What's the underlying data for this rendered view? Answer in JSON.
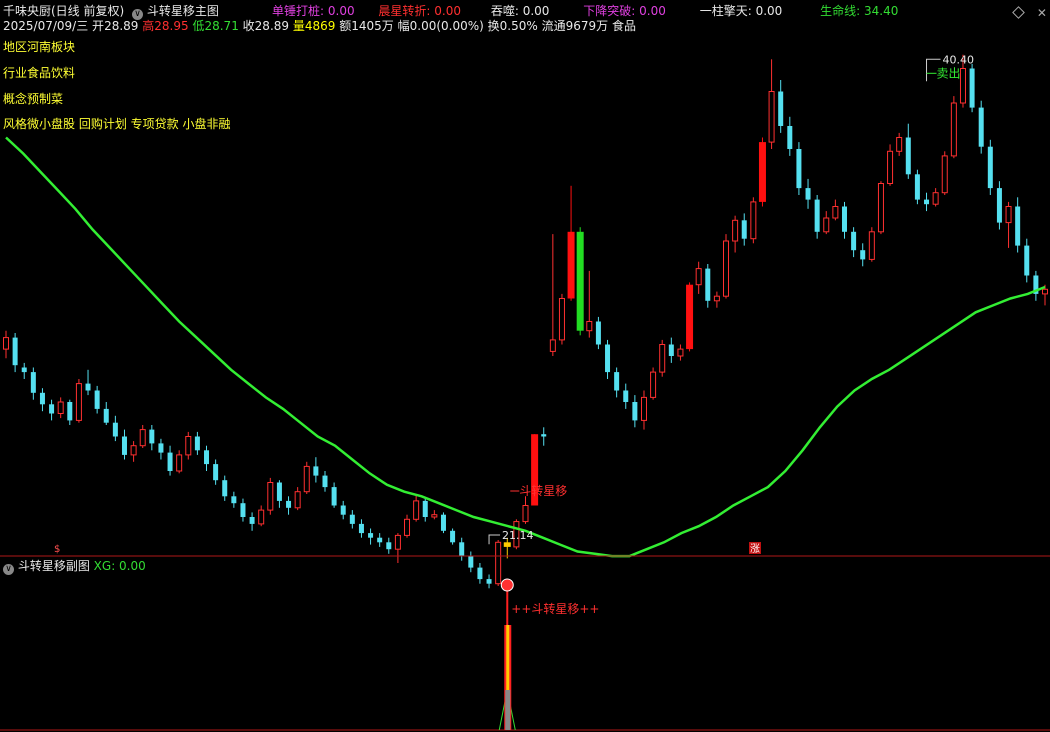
{
  "header": {
    "stock_name": "千味央厨(日线 前复权)",
    "formula_name": "斗转星移主图",
    "indicators": [
      {
        "label": "单锤打桩:",
        "value": "0.00",
        "color": "#e040e0"
      },
      {
        "label": "晨星转折:",
        "value": "0.00",
        "color": "#ff3030"
      },
      {
        "label": "吞噬:",
        "value": "0.00",
        "color": "#e8e8e8"
      },
      {
        "label": "下降突破:",
        "value": "0.00",
        "color": "#e040e0"
      },
      {
        "label": "一柱擎天:",
        "value": "0.00",
        "color": "#e8e8e8"
      },
      {
        "label": "生命线:",
        "value": "34.40",
        "color": "#33dd33"
      }
    ],
    "quote": {
      "date": "2025/07/09/三",
      "open_label": "开",
      "open": "28.89",
      "high_label": "高",
      "high": "28.95",
      "low_label": "低",
      "low": "28.71",
      "close_label": "收",
      "close": "28.89",
      "vol_label": "量",
      "vol": "4869",
      "amount": "额1405万",
      "change": "幅0.00(0.00%)",
      "turnover": "换0.50%",
      "float": "流通9679万",
      "sector": "食品"
    }
  },
  "side_info": [
    "地区河南板块",
    "行业食品饮料",
    "概念预制菜",
    "风格微小盘股 回购计划 专项贷款 小盘非融"
  ],
  "main_chart": {
    "high_label": "40.40",
    "sell_label": "卖出",
    "low_label": "21.14",
    "signal_label": "斗转星移",
    "bottom_markers": [
      "$",
      "涨"
    ],
    "colors": {
      "up": "#ff3030",
      "down": "#55e0f0",
      "ma": "#33ee33",
      "signal": "#ffcc00"
    },
    "ylim": [
      19.5,
      41.5
    ]
  },
  "sub_chart": {
    "title": "斗转星移副图",
    "xg_label": "XG: 0.00",
    "signal_label": "++斗转星移++"
  },
  "chart_data": {
    "type": "candlestick",
    "ohlc": [
      [
        27.8,
        28.6,
        27.4,
        28.3
      ],
      [
        28.3,
        28.5,
        26.8,
        27.1
      ],
      [
        27.0,
        27.2,
        26.5,
        26.8
      ],
      [
        26.8,
        27.0,
        25.6,
        25.9
      ],
      [
        25.9,
        26.1,
        25.1,
        25.4
      ],
      [
        25.4,
        25.6,
        24.7,
        25.0
      ],
      [
        25.0,
        25.7,
        24.8,
        25.5
      ],
      [
        25.5,
        25.6,
        24.5,
        24.7
      ],
      [
        24.7,
        26.5,
        24.6,
        26.3
      ],
      [
        26.3,
        26.9,
        25.8,
        26.0
      ],
      [
        26.0,
        26.2,
        25.0,
        25.2
      ],
      [
        25.2,
        25.5,
        24.5,
        24.6
      ],
      [
        24.6,
        24.9,
        23.8,
        24.0
      ],
      [
        24.0,
        24.3,
        23.0,
        23.2
      ],
      [
        23.2,
        23.8,
        22.9,
        23.6
      ],
      [
        23.6,
        24.5,
        23.5,
        24.3
      ],
      [
        24.3,
        24.5,
        23.4,
        23.7
      ],
      [
        23.7,
        23.9,
        23.0,
        23.3
      ],
      [
        23.3,
        23.6,
        22.3,
        22.5
      ],
      [
        22.5,
        23.4,
        22.4,
        23.2
      ],
      [
        23.2,
        24.2,
        23.0,
        24.0
      ],
      [
        24.0,
        24.2,
        23.2,
        23.4
      ],
      [
        23.4,
        23.6,
        22.5,
        22.8
      ],
      [
        22.8,
        23.0,
        21.9,
        22.1
      ],
      [
        22.1,
        22.3,
        21.2,
        21.4
      ],
      [
        21.4,
        21.6,
        20.9,
        21.1
      ],
      [
        21.1,
        21.3,
        20.3,
        20.5
      ],
      [
        20.5,
        20.7,
        19.9,
        20.2
      ],
      [
        20.2,
        21.0,
        20.1,
        20.8
      ],
      [
        20.8,
        22.2,
        20.6,
        22.0
      ],
      [
        22.0,
        22.1,
        20.9,
        21.2
      ],
      [
        21.2,
        21.4,
        20.6,
        20.9
      ],
      [
        20.9,
        21.8,
        20.8,
        21.6
      ],
      [
        21.6,
        22.9,
        21.5,
        22.7
      ],
      [
        22.7,
        23.1,
        22.0,
        22.3
      ],
      [
        22.3,
        22.5,
        21.6,
        21.8
      ],
      [
        21.8,
        22.0,
        20.9,
        21.0
      ],
      [
        21.0,
        21.2,
        20.4,
        20.6
      ],
      [
        20.6,
        20.8,
        20.0,
        20.2
      ],
      [
        20.2,
        20.4,
        19.6,
        19.8
      ],
      [
        19.8,
        20.0,
        19.3,
        19.6
      ],
      [
        19.6,
        19.8,
        19.2,
        19.4
      ],
      [
        19.4,
        19.6,
        18.9,
        19.1
      ],
      [
        19.1,
        19.8,
        18.5,
        19.7
      ],
      [
        19.7,
        20.6,
        19.6,
        20.4
      ],
      [
        20.4,
        21.5,
        20.3,
        21.2
      ],
      [
        21.2,
        21.3,
        20.3,
        20.5
      ],
      [
        20.5,
        20.8,
        20.4,
        20.6
      ],
      [
        20.6,
        20.7,
        19.8,
        19.9
      ],
      [
        19.9,
        20.0,
        19.3,
        19.4
      ],
      [
        19.4,
        19.6,
        18.6,
        18.8
      ],
      [
        18.8,
        19.0,
        18.1,
        18.3
      ],
      [
        18.3,
        18.5,
        17.6,
        17.8
      ],
      [
        17.8,
        18.0,
        17.4,
        17.6
      ],
      [
        17.6,
        19.5,
        17.5,
        19.4
      ],
      [
        19.4,
        19.6,
        18.7,
        19.2
      ],
      [
        19.2,
        20.4,
        19.1,
        20.3
      ],
      [
        20.3,
        21.4,
        20.2,
        21.0
      ],
      [
        21.0,
        24.1,
        21.0,
        24.1
      ],
      [
        24.1,
        24.4,
        23.6,
        24.0
      ],
      [
        27.7,
        32.8,
        27.5,
        28.2
      ],
      [
        28.2,
        30.2,
        28.0,
        30.0
      ],
      [
        30.0,
        34.9,
        29.9,
        32.9
      ],
      [
        32.9,
        33.1,
        28.4,
        28.6
      ],
      [
        28.6,
        31.2,
        28.3,
        29.0
      ],
      [
        29.0,
        29.2,
        27.8,
        28.0
      ],
      [
        28.0,
        28.2,
        26.5,
        26.8
      ],
      [
        26.8,
        27.0,
        25.7,
        26.0
      ],
      [
        26.0,
        26.3,
        25.2,
        25.5
      ],
      [
        25.5,
        25.8,
        24.4,
        24.7
      ],
      [
        24.7,
        26.0,
        24.3,
        25.7
      ],
      [
        25.7,
        27.0,
        25.6,
        26.8
      ],
      [
        26.8,
        28.2,
        26.6,
        28.0
      ],
      [
        28.0,
        28.3,
        27.2,
        27.5
      ],
      [
        27.5,
        28.0,
        27.3,
        27.8
      ],
      [
        27.8,
        30.7,
        27.7,
        30.6
      ],
      [
        30.6,
        31.6,
        30.2,
        31.3
      ],
      [
        31.3,
        31.5,
        29.6,
        29.9
      ],
      [
        29.9,
        30.3,
        29.6,
        30.1
      ],
      [
        30.1,
        32.8,
        30.0,
        32.5
      ],
      [
        32.5,
        33.6,
        32.0,
        33.4
      ],
      [
        33.4,
        33.7,
        32.3,
        32.6
      ],
      [
        32.6,
        34.4,
        32.4,
        34.2
      ],
      [
        34.2,
        37.0,
        34.0,
        36.8
      ],
      [
        36.8,
        40.4,
        36.5,
        39.0
      ],
      [
        39.0,
        39.5,
        37.2,
        37.5
      ],
      [
        37.5,
        37.9,
        36.2,
        36.5
      ],
      [
        36.5,
        36.8,
        34.5,
        34.8
      ],
      [
        34.8,
        35.2,
        33.9,
        34.3
      ],
      [
        34.3,
        34.5,
        32.6,
        32.9
      ],
      [
        32.9,
        33.8,
        32.8,
        33.5
      ],
      [
        33.5,
        34.3,
        33.4,
        34.0
      ],
      [
        34.0,
        34.2,
        32.6,
        32.9
      ],
      [
        32.9,
        33.1,
        31.8,
        32.1
      ],
      [
        32.1,
        32.4,
        31.4,
        31.7
      ],
      [
        31.7,
        33.1,
        31.6,
        32.9
      ],
      [
        32.9,
        35.1,
        32.8,
        35.0
      ],
      [
        35.0,
        36.7,
        34.9,
        36.4
      ],
      [
        36.4,
        37.2,
        36.2,
        37.0
      ],
      [
        37.0,
        37.6,
        35.2,
        35.4
      ],
      [
        35.4,
        35.6,
        34.1,
        34.3
      ],
      [
        34.3,
        34.6,
        33.8,
        34.1
      ],
      [
        34.1,
        34.8,
        34.0,
        34.6
      ],
      [
        34.6,
        36.4,
        34.5,
        36.2
      ],
      [
        36.2,
        38.8,
        36.1,
        38.5
      ],
      [
        38.5,
        40.6,
        38.3,
        40.0
      ],
      [
        40.0,
        40.2,
        38.1,
        38.3
      ],
      [
        38.3,
        38.6,
        36.3,
        36.6
      ],
      [
        36.6,
        36.9,
        34.5,
        34.8
      ],
      [
        34.8,
        35.1,
        33.0,
        33.3
      ],
      [
        33.3,
        34.2,
        32.2,
        34.0
      ],
      [
        34.0,
        34.4,
        32.0,
        32.3
      ],
      [
        32.3,
        32.6,
        30.7,
        31.0
      ],
      [
        31.0,
        31.2,
        29.9,
        30.2
      ],
      [
        30.2,
        30.6,
        29.7,
        30.4
      ]
    ],
    "life_line": [
      37.0,
      36.3,
      35.5,
      34.7,
      33.9,
      33.0,
      32.2,
      31.4,
      30.6,
      29.8,
      29.0,
      28.3,
      27.6,
      26.9,
      26.3,
      25.7,
      25.2,
      24.6,
      24.0,
      23.6,
      23.0,
      22.4,
      21.9,
      21.6,
      21.4,
      21.1,
      20.8,
      20.5,
      20.3,
      20.1,
      19.9,
      19.6,
      19.3,
      19.0,
      18.9,
      18.8,
      18.8,
      19.1,
      19.4,
      19.8,
      20.1,
      20.5,
      21.0,
      21.4,
      21.8,
      22.5,
      23.4,
      24.4,
      25.3,
      26.0,
      26.5,
      26.9,
      27.4,
      27.9,
      28.4,
      28.9,
      29.4,
      29.7,
      30.0,
      30.2,
      30.5
    ],
    "signal_index": 55,
    "high_index": 101,
    "low_index": 53
  }
}
